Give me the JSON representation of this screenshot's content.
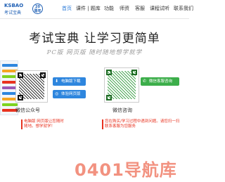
{
  "logo": {
    "mark": "KSBAO",
    "name": "考试宝典",
    "badge": "20\n周年"
  },
  "nav": {
    "items": [
      {
        "label": "首页",
        "active": true
      },
      {
        "label": "课件 | 题库",
        "active": false
      },
      {
        "label": "功能",
        "active": false
      },
      {
        "label": "师资",
        "active": false
      },
      {
        "label": "客服",
        "active": false
      },
      {
        "label": "课程试听",
        "active": false
      },
      {
        "label": "联系我们",
        "active": false
      }
    ]
  },
  "hero": {
    "title": "考试宝典  让学习更简单",
    "subtitle": "PC版 网页版 随时随地想学就学"
  },
  "left_qr": {
    "label": "微信公众号",
    "buttons": [
      {
        "label": "电脑版下载",
        "icon": "download-icon",
        "color": "#2e86de"
      },
      {
        "label": "体验网页版",
        "icon": "globe-icon",
        "color": "#2e86de"
      }
    ],
    "note": "电脑版 网页版让您随时 随地。想学就学！"
  },
  "right_qr": {
    "label": "微信咨询",
    "button": {
      "label": "微信客服咨询",
      "icon": "wechat-icon",
      "color": "#3cae4a"
    },
    "note": "您在购买/学习过程中遇到问题。请您扫一扫联系客服为您服务"
  },
  "watermark": "0401导航库",
  "colors": {
    "accent": "#2a7ad8",
    "note": "#e8321f",
    "green": "#3cae4a"
  }
}
